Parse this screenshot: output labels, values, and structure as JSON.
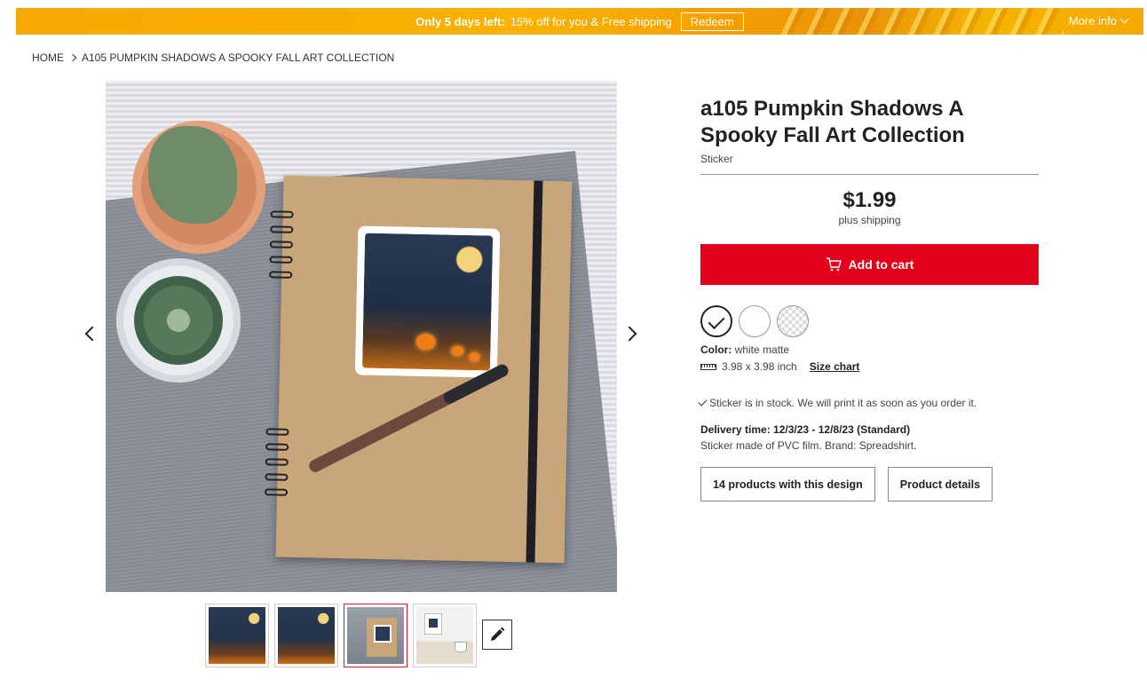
{
  "banner": {
    "highlight": "Only 5 days left:",
    "offer": "15% off for you & Free shipping",
    "redeem_label": "Redeem",
    "more_info_label": "More info"
  },
  "breadcrumb": {
    "home": "HOME",
    "current": "A105 PUMPKIN SHADOWS A SPOOKY FALL ART COLLECTION"
  },
  "product": {
    "title": "a105 Pumpkin Shadows A Spooky Fall Art Collection",
    "type": "Sticker",
    "price": "$1.99",
    "shipping_note": "plus shipping",
    "add_to_cart_label": "Add to cart",
    "color_label": "Color:",
    "color_value": "white matte",
    "size_value": "3.98 x 3.98 inch",
    "size_chart_label": "Size chart",
    "stock_text": "Sticker is in stock. We will print it as soon as you order it.",
    "delivery_text": "Delivery time: 12/3/23 - 12/8/23 (Standard)",
    "material_text": "Sticker made of PVC film. Brand: Spreadshirt.",
    "designs_button_label": "14 products with this design",
    "details_button_label": "Product details"
  },
  "gallery": {
    "selected_index": 2,
    "thumbnail_count": 4
  },
  "colors": {
    "accent": "#e2001a",
    "banner": "#f7a800"
  }
}
